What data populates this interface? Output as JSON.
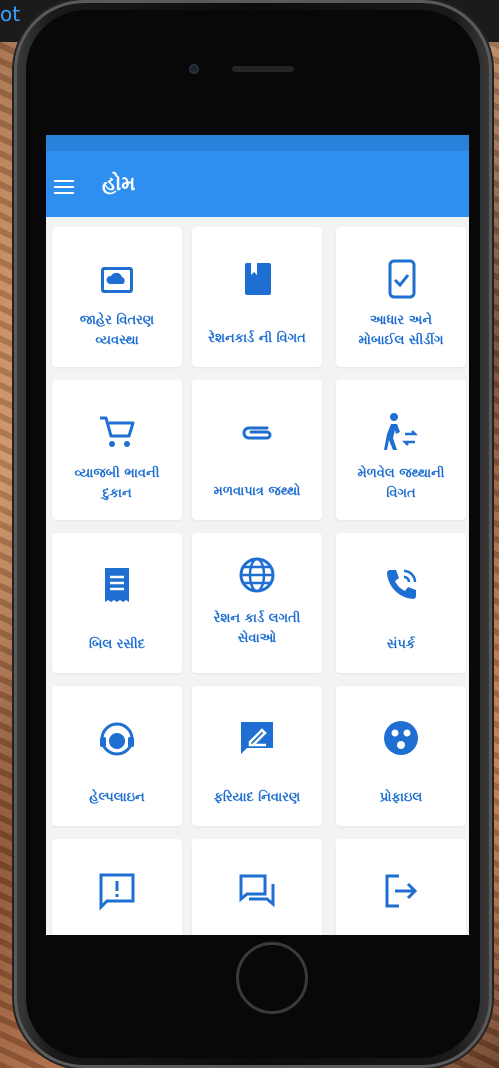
{
  "top_corner_text": "ot",
  "app": {
    "title": "હોમ"
  },
  "tiles": [
    {
      "label": "જાહેર વિતરણ\nવ્યવસ્થા",
      "icon": "cloud-card-icon"
    },
    {
      "label": "રેશનકાર્ડ ની વિગત",
      "icon": "book-icon"
    },
    {
      "label": "આધાર અને\nમોબાઈલ સીડીંગ",
      "icon": "phone-check-icon"
    },
    {
      "label": "વ્યાજબી ભાવની\nદુકાન",
      "icon": "cart-icon"
    },
    {
      "label": "મળવાપાત્ર જથ્થો",
      "icon": "paperclip-icon"
    },
    {
      "label": "મેળવેલ જથ્થાની\nવિગત",
      "icon": "walk-icon"
    },
    {
      "label": "બિલ રસીદ",
      "icon": "receipt-icon"
    },
    {
      "label": "રેશન કાર્ડ લગતી\nસેવાઓ",
      "icon": "globe-icon"
    },
    {
      "label": "સંપર્ક",
      "icon": "phone-call-icon"
    },
    {
      "label": "હેલ્પલાઇન",
      "icon": "headset-icon"
    },
    {
      "label": "ફરિયાદ નિવારણ",
      "icon": "feedback-icon"
    },
    {
      "label": "પ્રોફાઇલ",
      "icon": "profile-icon"
    },
    {
      "label": "",
      "icon": "alert-message-icon"
    },
    {
      "label": "",
      "icon": "forum-icon"
    },
    {
      "label": "",
      "icon": "logout-icon"
    }
  ],
  "colors": {
    "accent": "#2e8ff0",
    "icon": "#1e6fd1",
    "screen_bg": "#f1f3f5"
  }
}
